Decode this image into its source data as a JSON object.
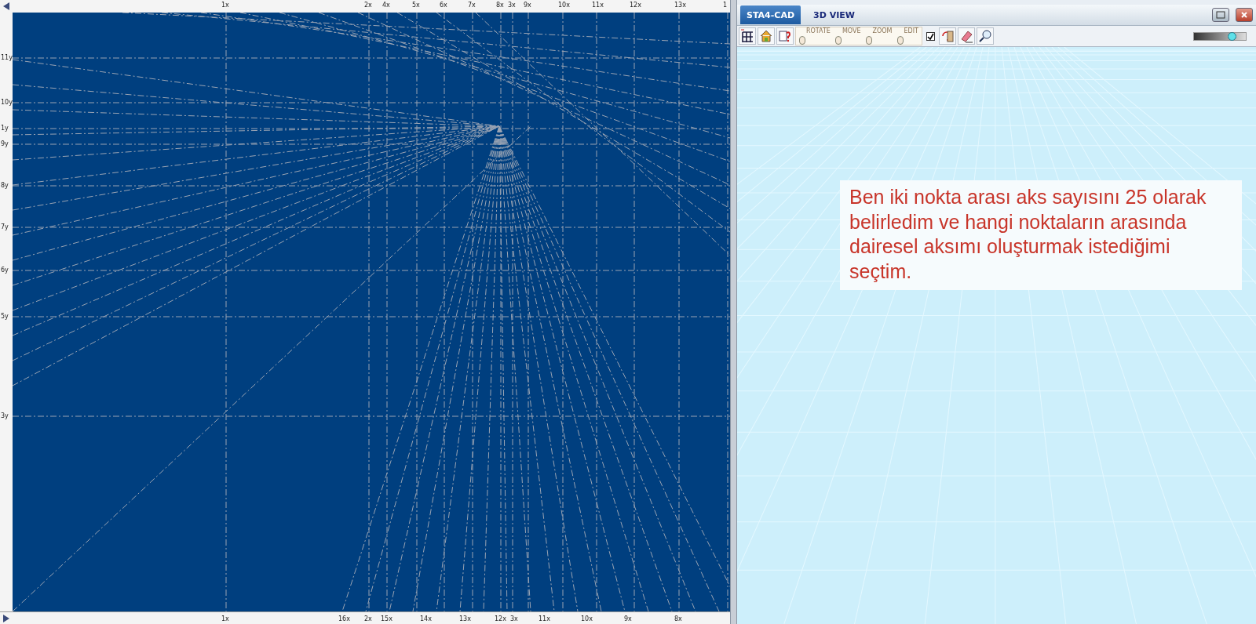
{
  "cad_view": {
    "top_axis_labels": [
      "1x",
      "2x",
      "4x",
      "5x",
      "6x",
      "7x",
      "8x",
      "3x",
      "9x",
      "10x",
      "11x",
      "12x",
      "13x",
      "1"
    ],
    "bottom_axis_labels": [
      "1x",
      "16x",
      "2x",
      "15x",
      "14x",
      "13x",
      "12x",
      "3x",
      "11x",
      "10x",
      "9x",
      "8x"
    ],
    "left_axis_labels": [
      "11y",
      "10y",
      "1y",
      "9y",
      "8y",
      "7y",
      "6y",
      "5y",
      "3y"
    ]
  },
  "view_3d": {
    "tabs": [
      {
        "label": "STA4-CAD",
        "selected": true
      },
      {
        "label": "3D VIEW",
        "selected": false
      }
    ],
    "mouse_modes": [
      "ROTATE",
      "MOVE",
      "ZOOM",
      "EDIT"
    ],
    "show_checkbox": {
      "checked": true
    },
    "brightness_slider": {
      "level": 0.72
    },
    "note": "Ben iki nokta arası aks sayısını 25 olarak belirledim ve hangi noktaların arasında dairesel aksımı oluşturmak istediğimi seçtim."
  }
}
